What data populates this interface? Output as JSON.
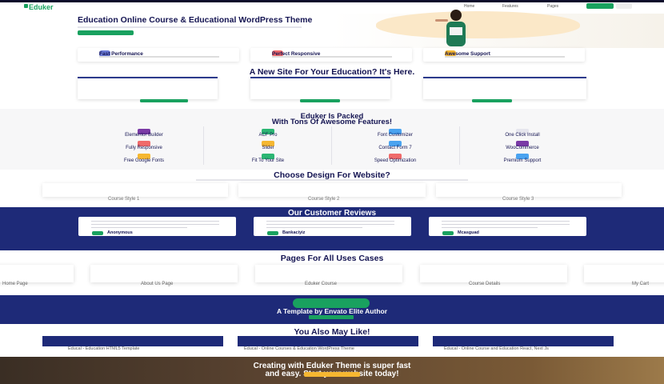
{
  "nav": {
    "logo": "Eduker",
    "links": [
      "Home",
      "Features",
      "Pages"
    ]
  },
  "hero": {
    "title": "Education Online Course & Educational WordPress Theme"
  },
  "features": [
    {
      "title": "Fast Performance",
      "color": "#6b7bd6"
    },
    {
      "title": "Perfect Responsive",
      "color": "#f06a6a"
    },
    {
      "title": "Awesome Support",
      "color": "#f5b731"
    }
  ],
  "new_site": {
    "title": "A New Site For Your Education? It's Here."
  },
  "packed": {
    "title_line1": "Eduker Is Packed",
    "title_line2": "With Tons Of Awesome Features!",
    "items": [
      {
        "label": "Elementor Builder",
        "color": "#7a3aa6"
      },
      {
        "label": "ACF Pro",
        "color": "#2bb673"
      },
      {
        "label": "Font Customizer",
        "color": "#4aa3f0"
      },
      {
        "label": "One Click Install",
        "color": "#e6e6ee"
      },
      {
        "label": "Fully Responsive",
        "color": "#f06a6a"
      },
      {
        "label": "Slider",
        "color": "#f5b731"
      },
      {
        "label": "Contact Form 7",
        "color": "#4aa3f0"
      },
      {
        "label": "WooCommerce",
        "color": "#7a3aa6"
      },
      {
        "label": "Free Google Fonts",
        "color": "#f5b731"
      },
      {
        "label": "Fit To Your Site",
        "color": "#2bb673"
      },
      {
        "label": "Speed Optimization",
        "color": "#f06a6a"
      },
      {
        "label": "Premium Support",
        "color": "#4aa3f0"
      }
    ]
  },
  "design": {
    "title": "Choose Design For Website?",
    "cards": [
      "Course Style 1",
      "Course Style 2",
      "Course Style 3"
    ]
  },
  "reviews": {
    "title": "Our Customer Reviews",
    "items": [
      {
        "name": "Anonymous"
      },
      {
        "name": "Bankaciyiz"
      },
      {
        "name": "Mcasguad"
      }
    ]
  },
  "pages": {
    "title": "Pages For All Uses Cases",
    "cards": [
      "Home Page",
      "About Us Page",
      "Eduker Course",
      "Course Details",
      "My Cart"
    ]
  },
  "author": {
    "title": "A Template by Envato Elite Author"
  },
  "like": {
    "title": "You Also May Like!",
    "items": [
      "Educal - Education HTML5 Template",
      "Educal - Online Courses & Education WordPress Theme",
      "Educal - Online Course and Education React, Next Js"
    ]
  },
  "footer": {
    "title_line1": "Creating with Eduker Theme is super fast",
    "title_line2": "and easy. Start your website today!"
  },
  "colors": {
    "brand_green": "#19a15f",
    "navy": "#141452",
    "review_bg": "#1e2a78",
    "accent_yellow": "#f5b731"
  }
}
